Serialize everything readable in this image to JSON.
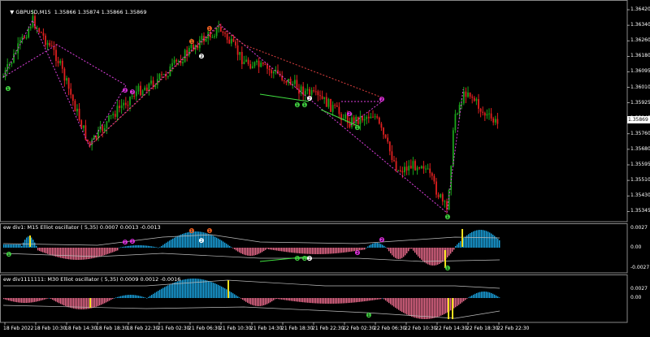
{
  "main_panel": {
    "symbol_label": "GBPUSD,M15",
    "ohlc": "1.35866 1.35874 1.35866 1.35869",
    "current_price": "1.35869",
    "price_ticks": [
      "1.36420",
      "1.36340",
      "1.36260",
      "1.36180",
      "1.36095",
      "1.36010",
      "1.35925",
      "1.35845",
      "1.35760",
      "1.35680",
      "1.35595",
      "1.35510",
      "1.35430",
      "1.35345"
    ]
  },
  "osc1": {
    "label": "ew div1: M15 Elliot oscillator ( 5,35) 0.0007 0.0013 -0.0013",
    "ticks": [
      "0.0027",
      "0.00",
      "-0.0027"
    ]
  },
  "osc2": {
    "label": "ew div1111111: M30 Elliot oscillator ( 5,35) 0.0009 0.0012 -0.0016",
    "ticks": [
      "0.0027",
      "0.00"
    ]
  },
  "time_axis": [
    "18 Feb 2022",
    "18 Feb 10:30",
    "18 Feb 14:30",
    "18 Feb 18:30",
    "18 Feb 22:30",
    "21 Feb 02:30",
    "21 Feb 06:30",
    "21 Feb 10:30",
    "21 Feb 14:30",
    "21 Feb 18:30",
    "21 Feb 22:30",
    "22 Feb 02:30",
    "22 Feb 06:30",
    "22 Feb 10:30",
    "22 Feb 14:30",
    "22 Feb 18:30",
    "22 Feb 22:30"
  ],
  "colors": {
    "background": "#000000",
    "bull_candle": "#1aa51a",
    "bear_candle": "#e02020",
    "osc_positive": "#1aa3e0",
    "osc_negative": "#e86a8a",
    "zigzag_pink": "#e040e0",
    "zigzag_red": "#e04040",
    "signal_yellow": "#f0e020",
    "grid": "#ffffff"
  },
  "markers": {
    "orange": "❶",
    "magenta": "❷",
    "green": "❶",
    "white": "❷"
  }
}
